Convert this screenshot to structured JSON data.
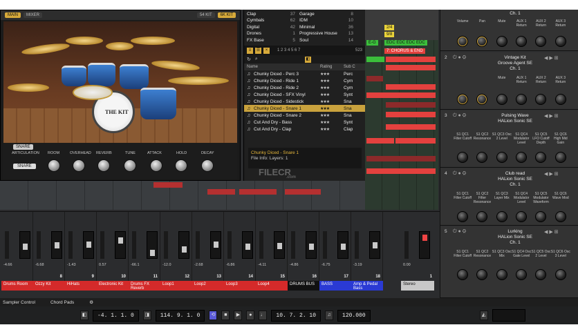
{
  "instrument": {
    "tab_main": "MAIN",
    "tab_mix": "MIXER",
    "tab_right_1": "54 KIT",
    "tab_right_2": "6K KIT",
    "kit_label": "THE KIT",
    "snare_button": "SNARE",
    "articulation_button": "SNARE",
    "controls": [
      "ARTICULATION",
      "ROOM",
      "OVERHEAD",
      "REVERB",
      "TUNE",
      "ATTACK",
      "HOLD",
      "DECAY"
    ]
  },
  "browser": {
    "categories": [
      {
        "name": "Clap",
        "count": "37",
        "name2": "Garage",
        "count2": "8"
      },
      {
        "name": "Cymbals",
        "count": "62",
        "name2": "IDM",
        "count2": "10"
      },
      {
        "name": "Digital",
        "count": "42",
        "name2": "Minimal",
        "count2": "36"
      },
      {
        "name": "Drones",
        "count": "1",
        "name2": "Progressive House",
        "count2": "13"
      },
      {
        "name": "FX Base",
        "count": "5",
        "name2": "Soul",
        "count2": "14"
      }
    ],
    "pages": "1 2 3 4 5 6 7",
    "count": "523",
    "headers": {
      "name": "Name",
      "rating": "Rating",
      "sub": "Sub C"
    },
    "rows": [
      {
        "name": "Chunky Diced - Perc 3",
        "rating": "★★★",
        "sub": "Perc"
      },
      {
        "name": "Chunky Diced - Ride 1",
        "rating": "★★★",
        "sub": "Cym"
      },
      {
        "name": "Chunky Diced - Ride 2",
        "rating": "★★★",
        "sub": "Cym"
      },
      {
        "name": "Chunky Diced - SFX Vinyl",
        "rating": "★★★",
        "sub": "Synt"
      },
      {
        "name": "Chunky Diced - Sidestick",
        "rating": "★★★",
        "sub": "Sna"
      },
      {
        "name": "Chunky Diced - Snare 1",
        "rating": "★★★",
        "sub": "Sna"
      },
      {
        "name": "Chunky Diced - Snare 2",
        "rating": "★★★",
        "sub": "Sna"
      },
      {
        "name": "Cut And Dry - Bass",
        "rating": "★★★",
        "sub": "Synt"
      },
      {
        "name": "Cut And Dry - Clap",
        "rating": "★★★",
        "sub": "Clap"
      }
    ],
    "info_name": "Chunky Diced - Snare 1",
    "info_sub": "File Info: Layers: 1"
  },
  "arrange": {
    "markers": {
      "sig1": "2/4",
      "sig2": "9/8",
      "chorus": "7: CHORUS & END",
      "ev": "E-G",
      "evs": "EDC EDC EDC EDC"
    }
  },
  "rack": {
    "top_labels": [
      "Volume",
      "Pan",
      "Mute",
      "AUX 1 Return",
      "AUX 2 Return",
      "AUX 3 Return"
    ],
    "top_channel": "Ch. 1",
    "slots": [
      {
        "num": "2",
        "name": "Vintage Kit",
        "sub": "Groove Agent SE",
        "ch": "Ch. 1",
        "labels": [
          "",
          "",
          "Mute",
          "AUX 1 Return",
          "AUX 2 Return",
          "AUX 3 Return"
        ]
      },
      {
        "num": "3",
        "name": "Pulsing Wave",
        "sub": "HALion Sonic SE",
        "ch": "",
        "labels": [
          "S1 QC1 Filter Cutoff",
          "S1 QC2 Resonance",
          "S1 QC3 Osc 2 Level",
          "S1 QC4 Modulator Level",
          "S1 QC5 LFO Cutoff Depth",
          "S1 QC6 High Mid Gain"
        ]
      },
      {
        "num": "4",
        "name": "Club read",
        "sub": "HALion Sonic SE",
        "ch": "Ch. 1",
        "labels": [
          "S1 QC1 Filter Cutoff",
          "S1 QC2 Filter Resonance",
          "S1 QC3 Layer Mix",
          "S1 QC4 Modulator Level",
          "S1 QC5 Modulator Waveform",
          "S1 QC6 Wave Mod"
        ]
      },
      {
        "num": "5",
        "name": "Lurking",
        "sub": "HALion Sonic SE",
        "ch": "Ch. 1",
        "labels": [
          "S1 QC1 Filter Cutoff",
          "S1 QC2 Resonance",
          "S1 QC3 Osc Mix",
          "S1 QC4 Osc Gate Level",
          "S1 QC5 Osc 2 Level",
          "S1 QC6 Osc 3 Level"
        ]
      }
    ]
  },
  "mixer": {
    "channels": [
      {
        "num": "",
        "vol": "-4.66",
        "name": "Drums Room",
        "color": "#d42a2a",
        "fader": 0.55
      },
      {
        "num": "8",
        "vol": "-6.68",
        "name": "Ozzy Kit",
        "color": "#d42a2a",
        "fader": 0.5
      },
      {
        "num": "9",
        "vol": "-1.43",
        "name": "HiHats",
        "color": "#d42a2a",
        "fader": 0.45
      },
      {
        "num": "10",
        "vol": "0.57",
        "name": "Electronic Kit",
        "color": "#d42a2a",
        "fader": 0.25
      },
      {
        "num": "11",
        "vol": "-66.1",
        "name": "Drums FX Reverb",
        "color": "#d42a2a",
        "fader": 0.85
      },
      {
        "num": "12",
        "vol": "-12.0",
        "name": "Loop1",
        "color": "#d42a2a",
        "fader": 0.7
      },
      {
        "num": "13",
        "vol": "-2.68",
        "name": "Loop2",
        "color": "#d42a2a",
        "fader": 0.48
      },
      {
        "num": "14",
        "vol": "-6.86",
        "name": "Loop3",
        "color": "#d42a2a",
        "fader": 0.55
      },
      {
        "num": "15",
        "vol": "-4.11",
        "name": "Loop4",
        "color": "#d42a2a",
        "fader": 0.52
      },
      {
        "num": "16",
        "vol": "-4.86",
        "name": "DRUMS BUS",
        "color": "#111111",
        "fader": 0.55
      },
      {
        "num": "17",
        "vol": "-6.75",
        "name": "BASS",
        "color": "#2a3ad4",
        "fader": 0.55
      },
      {
        "num": "18",
        "vol": "-3.19",
        "name": "Amp & Pedal Bass",
        "color": "#2a3ad4",
        "fader": 0.5
      }
    ],
    "stereo": {
      "num": "1",
      "vol": "0.00",
      "name": "Stereo"
    }
  },
  "tabs": [
    "Sampler Control",
    "Chord Pads"
  ],
  "transport": {
    "left_pos": "-4. 1. 1.  0",
    "right_pos": "114. 9. 1.  0",
    "time": "10. 7. 2.  10",
    "tempo": "120.000"
  },
  "watermark": {
    "main": "FILECR",
    "sub": ".com"
  }
}
